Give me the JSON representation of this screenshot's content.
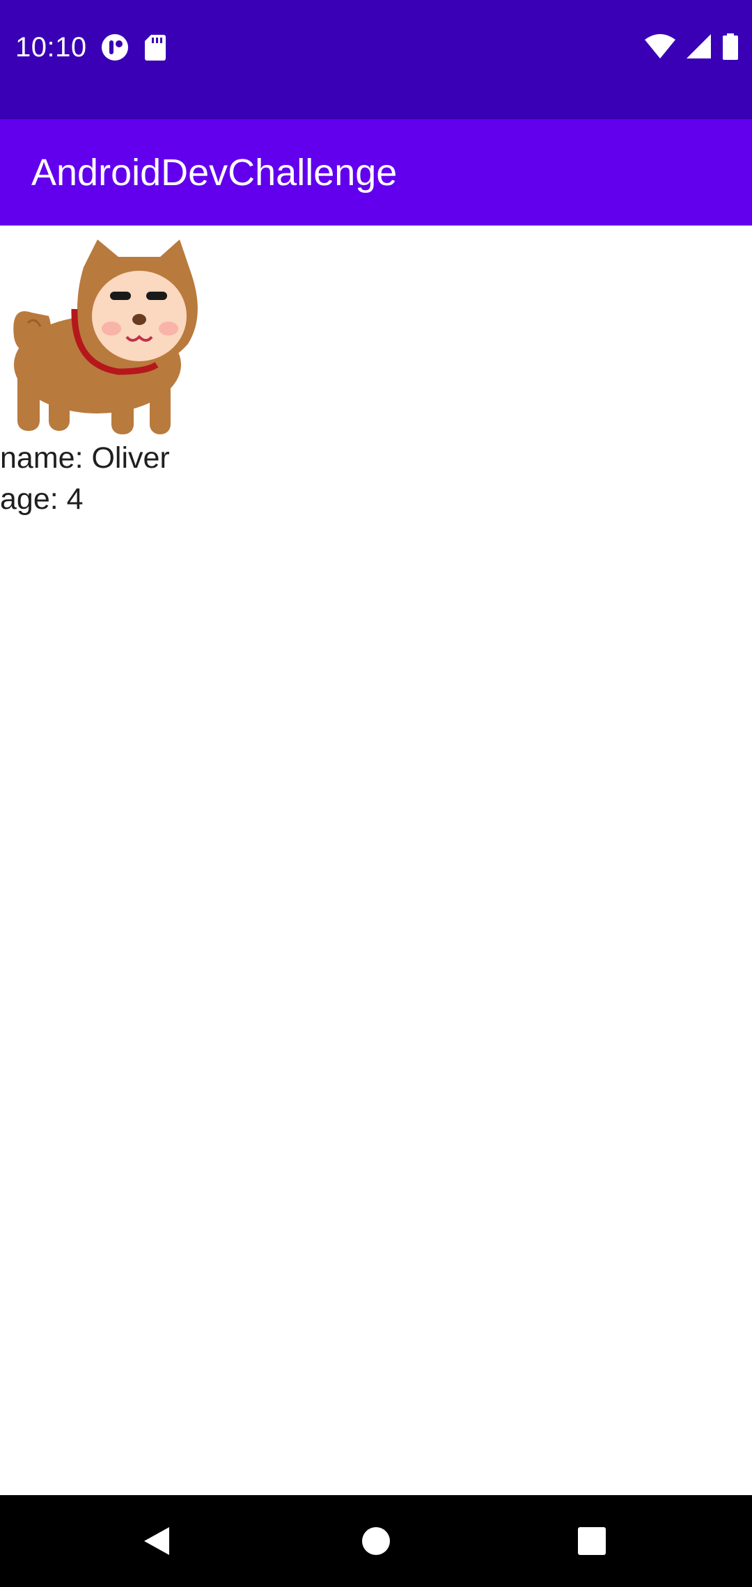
{
  "status_bar": {
    "time": "10:10",
    "left_icons": [
      "app-notification-icon",
      "sd-card-icon"
    ],
    "right_icons": [
      "wifi-icon",
      "cell-signal-icon",
      "battery-icon"
    ],
    "background": "#3a00b5"
  },
  "app_bar": {
    "title": "AndroidDevChallenge",
    "background": "#6200ee"
  },
  "dog": {
    "image_icon": "dog-illustration",
    "name_text": "name: Oliver",
    "age_text": "age: 4"
  },
  "nav_bar": {
    "buttons": [
      "back-icon",
      "home-icon",
      "recents-icon"
    ],
    "background": "#000000"
  }
}
